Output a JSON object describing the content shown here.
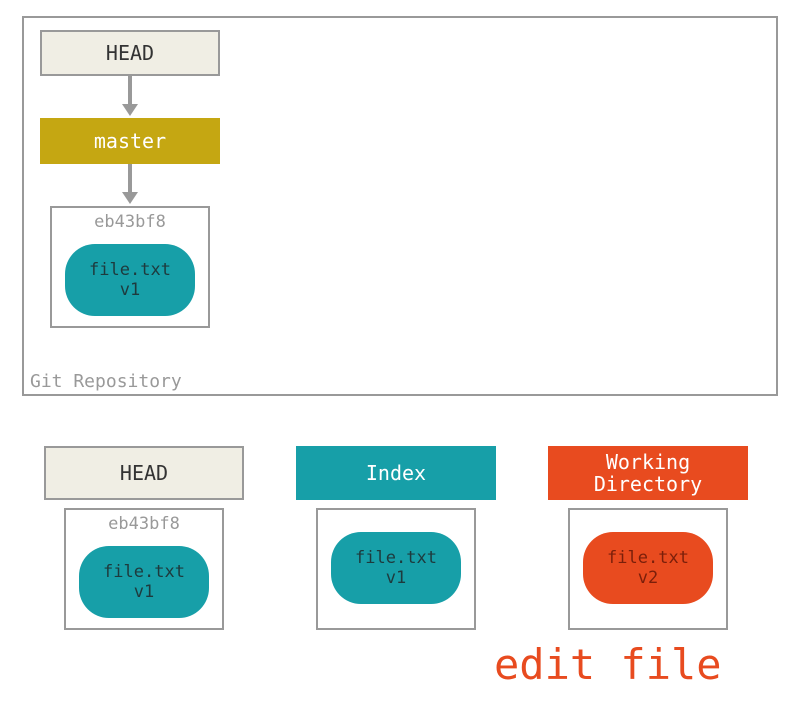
{
  "repo": {
    "label": "Git Repository",
    "head": "HEAD",
    "branch": "master",
    "commit_hash": "eb43bf8",
    "file_name": "file.txt",
    "file_version": "v1"
  },
  "columns": {
    "head": {
      "label": "HEAD",
      "commit_hash": "eb43bf8",
      "file_name": "file.txt",
      "file_version": "v1"
    },
    "index": {
      "label": "Index",
      "file_name": "file.txt",
      "file_version": "v1"
    },
    "workdir": {
      "label_line1": "Working",
      "label_line2": "Directory",
      "file_name": "file.txt",
      "file_version": "v2"
    }
  },
  "action": "edit file"
}
